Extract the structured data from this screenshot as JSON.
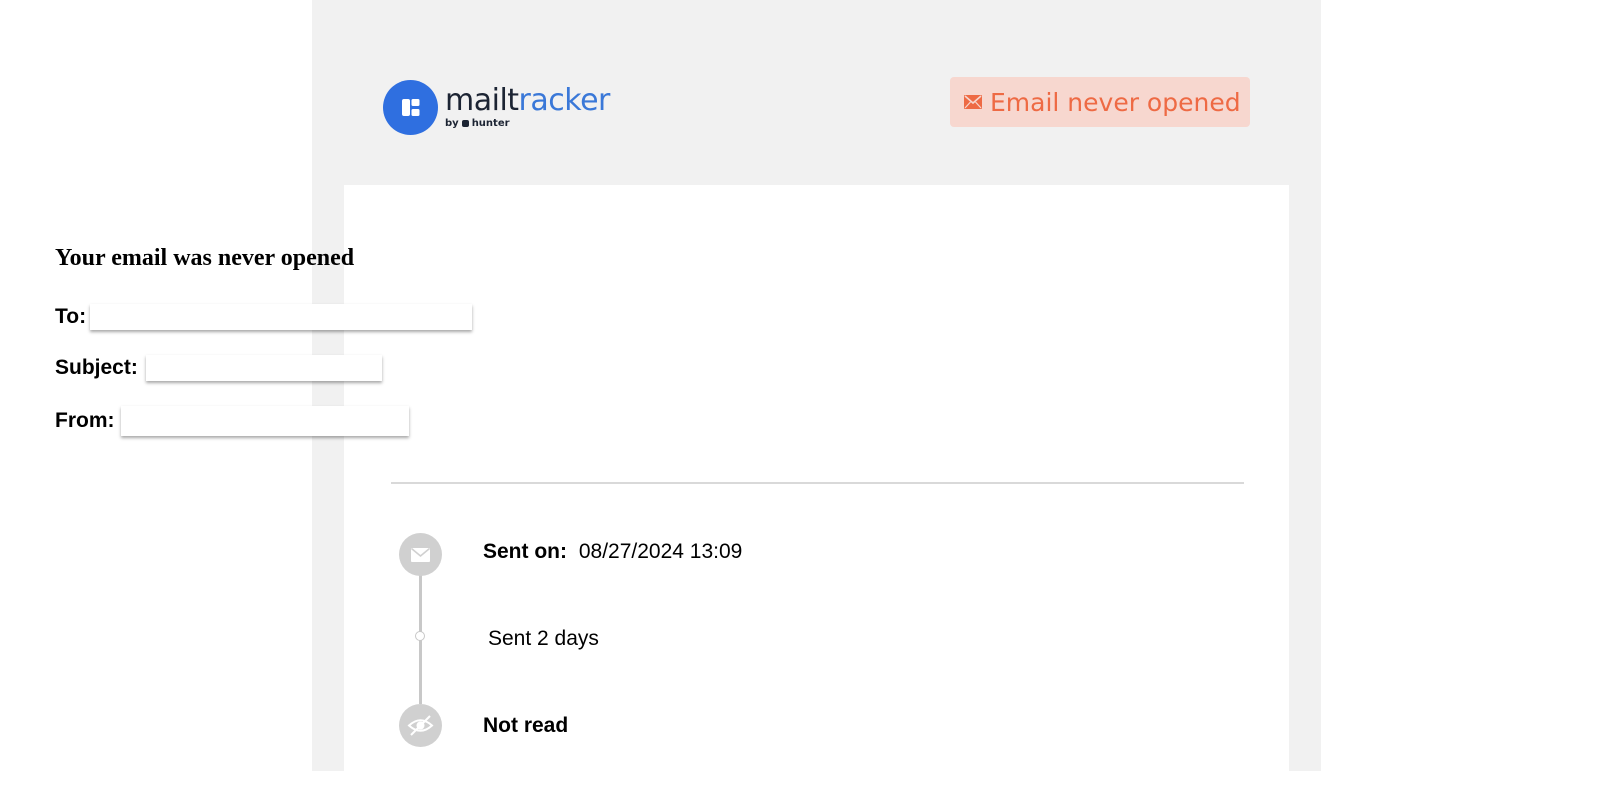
{
  "brand": {
    "name_part1": "mailt",
    "name_part2": "racker",
    "by_label": "by",
    "company": "hunter"
  },
  "status_badge": {
    "label": "Email never opened",
    "icon": "envelope-icon",
    "color": "#ee6a44",
    "background": "#f7d7cf"
  },
  "report": {
    "title": "Your email was never opened",
    "fields": {
      "to_label": "To:",
      "subject_label": "Subject:",
      "from_label": "From:"
    }
  },
  "timeline": {
    "sent_on_label": "Sent on:",
    "sent_on_value": "08/27/2024 13:09",
    "elapsed": "Sent 2 days",
    "status": "Not read",
    "icons": [
      "envelope-icon",
      "eye-slash-icon"
    ]
  },
  "colors": {
    "brand_blue": "#2f6fe0",
    "page_bg": "#f1f1f1",
    "timeline_gray": "#c8c8c8"
  }
}
